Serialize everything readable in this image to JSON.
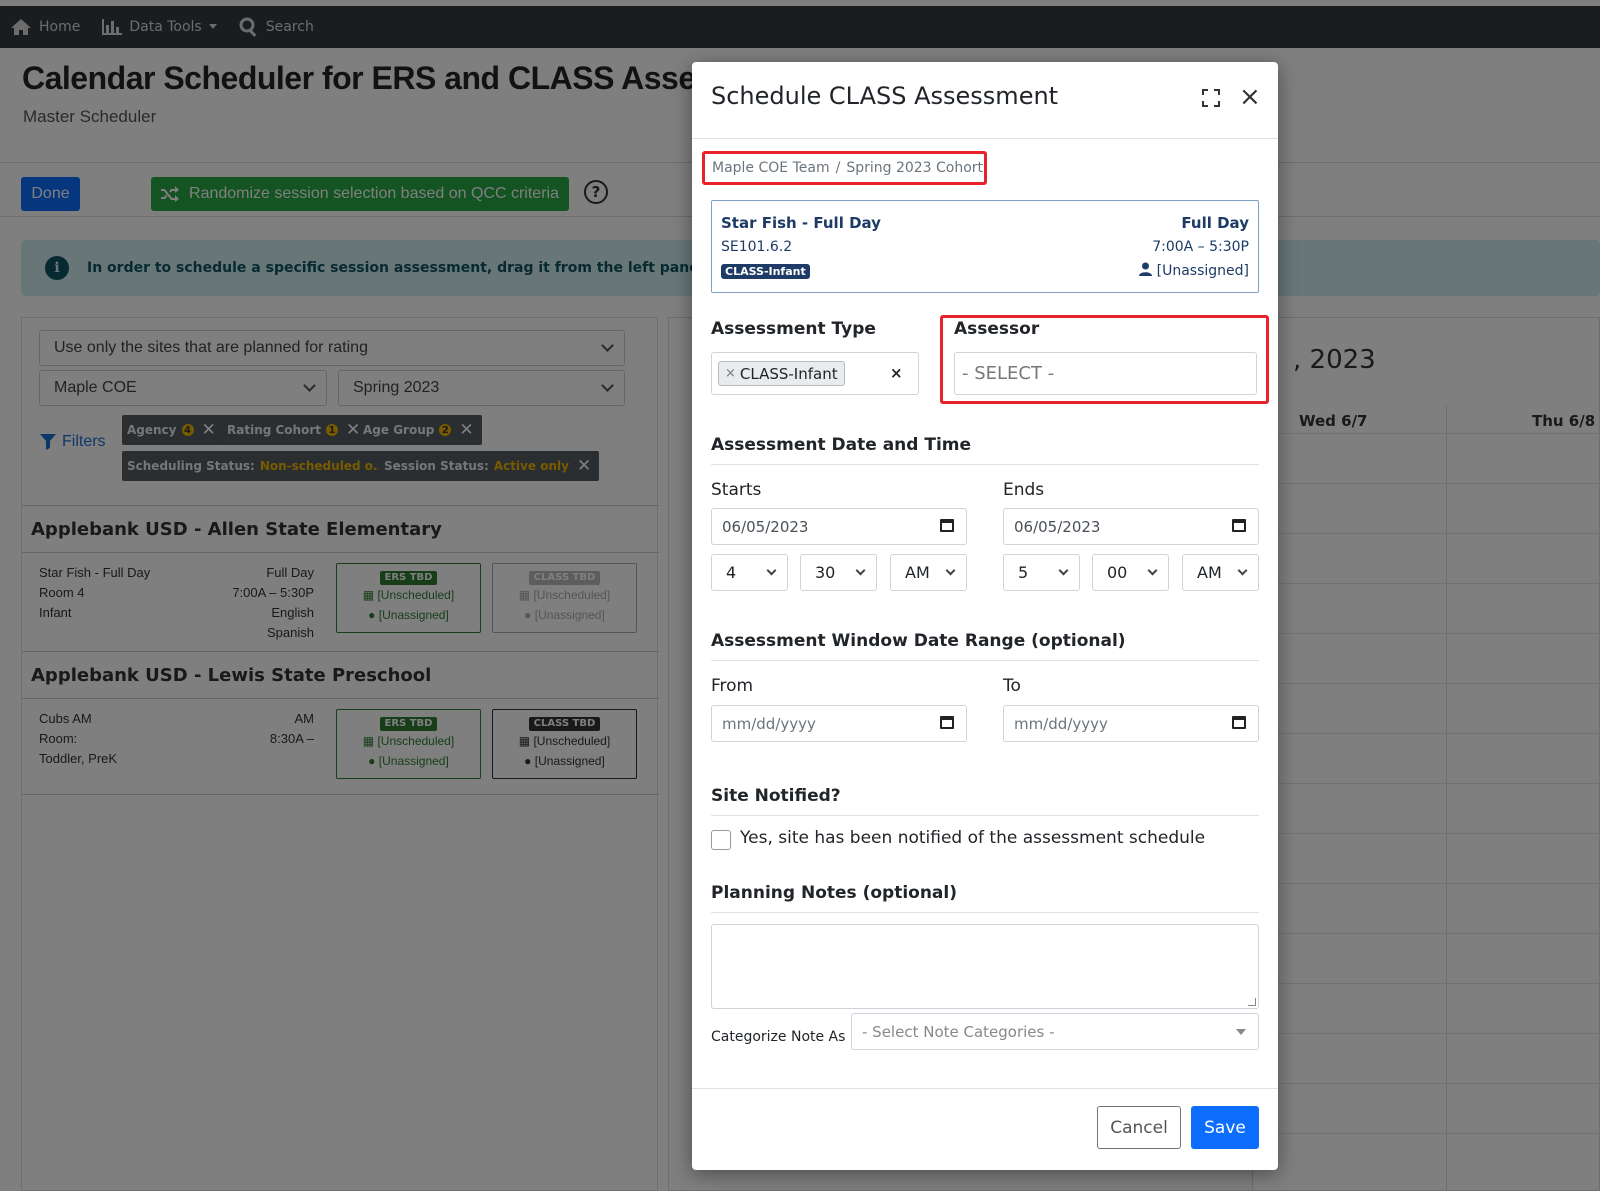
{
  "nav": {
    "home": "Home",
    "data_tools": "Data Tools",
    "search": "Search"
  },
  "page": {
    "title": "Calendar Scheduler for ERS and CLASS Assessments",
    "subtitle": "Master Scheduler",
    "done_label": "Done",
    "randomize_label": "Randomize session selection based on QCC criteria",
    "help_glyph": "?",
    "info_glyph": "i",
    "info_text": "In order to schedule a specific session assessment, drag it from the left panel onto the calendar"
  },
  "filters": {
    "site_scope": "Use only the sites that are planned for rating",
    "agency": "Maple COE",
    "cohort": "Spring 2023",
    "filters_link": "Filters",
    "chips": [
      {
        "label": "Agency",
        "badge": "4"
      },
      {
        "label": "Rating Cohort",
        "badge": "1"
      },
      {
        "label": "Age Group",
        "badge": "2"
      },
      {
        "label": "Scheduling Status:",
        "value": "Non-scheduled o..."
      },
      {
        "label": "Session Status:",
        "value": "Active only"
      }
    ]
  },
  "sites": [
    {
      "title": "Applebank USD - Allen State Elementary",
      "session": {
        "name": "Star Fish - Full Day",
        "room": "Room 4",
        "age": "Infant",
        "schedule": "Full Day",
        "time": "7:00A – 5:30P",
        "lang1": "English",
        "lang2": "Spanish"
      },
      "cards": [
        {
          "tag": "ERS TBD",
          "line1": "[Unscheduled]",
          "line2": "[Unassigned]"
        },
        {
          "tag": "CLASS TBD",
          "line1": "[Unscheduled]",
          "line2": "[Unassigned]"
        }
      ]
    },
    {
      "title": "Applebank USD - Lewis State Preschool",
      "session": {
        "name": "Cubs AM",
        "room": "Room:",
        "age": "Toddler, PreK",
        "schedule": "AM",
        "time": "8:30A –"
      },
      "cards": [
        {
          "tag": "ERS TBD",
          "line1": "[Unscheduled]",
          "line2": "[Unassigned]"
        },
        {
          "tag": "CLASS TBD",
          "line1": "[Unscheduled]",
          "line2": "[Unassigned]"
        }
      ]
    }
  ],
  "calendar": {
    "title_fragment": ", 2023",
    "days": [
      "Wed 6/7",
      "Thu 6/8"
    ]
  },
  "modal": {
    "title": "Schedule CLASS Assessment",
    "close_glyph": "×",
    "breadcrumb": [
      "Maple COE Team",
      "/",
      "Spring 2023 Cohort"
    ],
    "session": {
      "name": "Star Fish - Full Day",
      "code": "SE101.6.2",
      "tag": "CLASS-Infant",
      "schedule": "Full Day",
      "time": "7:00A – 5:30P",
      "assessor": "[Unassigned]"
    },
    "assessment_type_label": "Assessment Type",
    "assessment_type_value": "CLASS-Infant",
    "chip_remove_glyph": "×",
    "clear_glyph": "×",
    "assessor_label": "Assessor",
    "assessor_value": "- SELECT -",
    "datetime_heading": "Assessment Date and Time",
    "starts_label": "Starts",
    "ends_label": "Ends",
    "start_date": "06/05/2023",
    "end_date": "06/05/2023",
    "start_hour": "4",
    "start_minute": "30",
    "start_ampm": "AM",
    "end_hour": "5",
    "end_minute": "00",
    "end_ampm": "AM",
    "window_heading": "Assessment Window Date Range (optional)",
    "from_label": "From",
    "to_label": "To",
    "from_placeholder": "mm/dd/yyyy",
    "to_placeholder": "mm/dd/yyyy",
    "site_notified_heading": "Site Notified?",
    "site_notified_text": "Yes, site has been notified of the assessment schedule",
    "notes_heading": "Planning Notes (optional)",
    "categorize_label": "Categorize Note As",
    "categorize_placeholder": "- Select Note Categories -",
    "cancel_label": "Cancel",
    "save_label": "Save"
  },
  "colors": {
    "primary": "#0d6efd",
    "success": "#28a745",
    "highlight": "#e8212b",
    "navbar": "#343a40"
  }
}
